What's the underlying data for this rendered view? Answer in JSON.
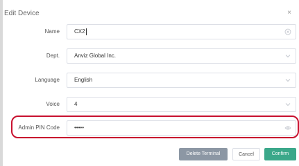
{
  "dialog": {
    "title": "Edit Device",
    "close_symbol": "×",
    "close_icon": "close-icon"
  },
  "form": {
    "name": {
      "label": "Name",
      "value": "CX2",
      "suffix_icon": "clear-circle-icon"
    },
    "dept": {
      "label": "Dept.",
      "value": "Anviz Global Inc.",
      "suffix_icon": "chevron-down-icon"
    },
    "language": {
      "label": "Language",
      "value": "English",
      "suffix_icon": "chevron-down-icon"
    },
    "voice": {
      "label": "Voice",
      "value": "4",
      "suffix_icon": "chevron-down-icon"
    },
    "admin_pin": {
      "label": "Admin PIN Code",
      "value": "•••••",
      "suffix_icon": "eye-icon"
    }
  },
  "buttons": {
    "delete_label": "Delete Terminal",
    "cancel_label": "Cancel",
    "confirm_label": "Confirm"
  },
  "colors": {
    "highlight": "#c8102e",
    "confirm": "#3ba88a",
    "delete": "#8c97a4"
  }
}
